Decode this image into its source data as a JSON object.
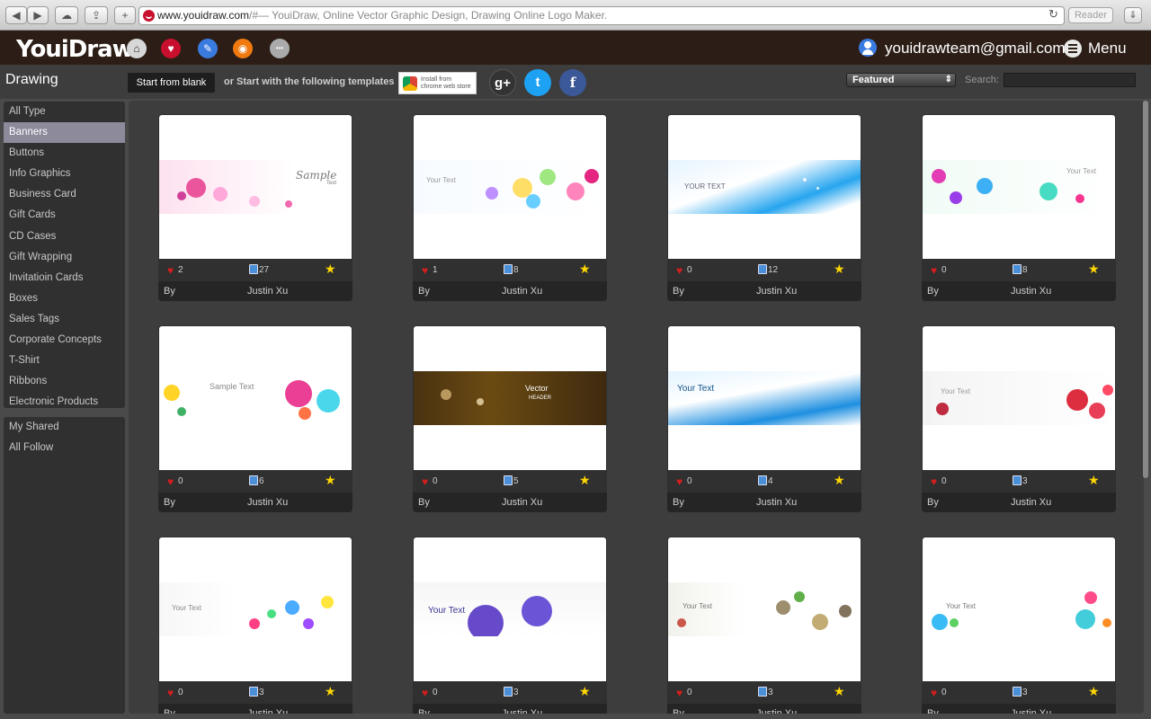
{
  "browser": {
    "back": "◀",
    "forward": "▶",
    "cloud": "☁",
    "share": "⇪",
    "new_tab": "+",
    "url_main": "www.youidraw.com",
    "url_rest": "/#— YouiDraw, Online Vector Graphic Design, Drawing Online Logo Maker.",
    "reload": "↻",
    "reader": "Reader",
    "download": "⇓"
  },
  "header": {
    "logo": "YouiDraw",
    "icons": [
      "home-icon",
      "heart-icon",
      "feather-icon",
      "logo-tool-icon",
      "more-icon"
    ],
    "more_glyph": "•••",
    "user_email": "youidrawteam@gmail.com",
    "menu_label": "Menu"
  },
  "toolbar": {
    "title": "Drawing",
    "blank_button": "Start from blank",
    "or_text": "or Start with the following templates",
    "chrome_store_line1": "Install from",
    "chrome_store_line2": "chrome web store",
    "gplus": "g+",
    "twitter": "t",
    "facebook": "f",
    "sort_selected": "Featured",
    "search_label": "Search:",
    "search_value": ""
  },
  "sidebar": {
    "categories": [
      "All Type",
      "Banners",
      "Buttons",
      "Info Graphics",
      "Business Card",
      "Gift Cards",
      "CD Cases",
      "Gift Wrapping",
      "Invitatioin Cards",
      "Boxes",
      "Sales Tags",
      "Corporate Concepts",
      "T-Shirt",
      "Ribbons",
      "Electronic Products"
    ],
    "active_index": 1,
    "personal": [
      "My Shared",
      "All Follow"
    ]
  },
  "cards": [
    {
      "likes": "2",
      "edits": "27",
      "by": "By",
      "author": "Justin Xu",
      "text": "Sample",
      "sub": "Text"
    },
    {
      "likes": "1",
      "edits": "8",
      "by": "By",
      "author": "Justin Xu",
      "text": "Your Text"
    },
    {
      "likes": "0",
      "edits": "12",
      "by": "By",
      "author": "Justin Xu",
      "text": "YOUR TEXT"
    },
    {
      "likes": "0",
      "edits": "8",
      "by": "By",
      "author": "Justin Xu",
      "text": "Your Text"
    },
    {
      "likes": "0",
      "edits": "6",
      "by": "By",
      "author": "Justin Xu",
      "text": "Sample Text"
    },
    {
      "likes": "0",
      "edits": "5",
      "by": "By",
      "author": "Justin Xu",
      "text": "Vector",
      "sub": "HEADER"
    },
    {
      "likes": "0",
      "edits": "4",
      "by": "By",
      "author": "Justin Xu",
      "text": "Your Text"
    },
    {
      "likes": "0",
      "edits": "3",
      "by": "By",
      "author": "Justin Xu",
      "text": "Your Text"
    },
    {
      "likes": "0",
      "edits": "3",
      "by": "By",
      "author": "Justin Xu",
      "text": "Your Text"
    },
    {
      "likes": "0",
      "edits": "3",
      "by": "By",
      "author": "Justin Xu",
      "text": "Your Text"
    },
    {
      "likes": "0",
      "edits": "3",
      "by": "By",
      "author": "Justin Xu",
      "text": "Your Text"
    },
    {
      "likes": "0",
      "edits": "3",
      "by": "By",
      "author": "Justin Xu",
      "text": "Your Text"
    }
  ],
  "colors": {
    "header_bg": "#2c1e16",
    "active_category": "#8c8a9b",
    "heart": "#d21e1e",
    "star": "#ffd700"
  }
}
